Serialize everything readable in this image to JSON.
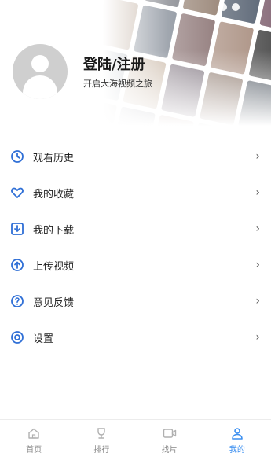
{
  "profile": {
    "title": "登陆/注册",
    "subtitle": "开启大海视频之旅"
  },
  "menu": {
    "items": [
      {
        "label": "观看历史",
        "icon": "history-icon"
      },
      {
        "label": "我的收藏",
        "icon": "heart-icon"
      },
      {
        "label": "我的下载",
        "icon": "download-icon"
      },
      {
        "label": "上传视频",
        "icon": "upload-icon"
      },
      {
        "label": "意见反馈",
        "icon": "question-icon"
      },
      {
        "label": "设置",
        "icon": "settings-icon"
      }
    ],
    "chevron": "›"
  },
  "tabs": [
    {
      "label": "首页",
      "icon": "home-icon",
      "active": false
    },
    {
      "label": "排行",
      "icon": "trophy-icon",
      "active": false
    },
    {
      "label": "找片",
      "icon": "video-icon",
      "active": false
    },
    {
      "label": "我的",
      "icon": "user-icon",
      "active": true
    }
  ],
  "colors": {
    "accent": "#3a8ef0",
    "icon_blue": "#2f6fd6",
    "tab_inactive": "#b0b0b0"
  }
}
